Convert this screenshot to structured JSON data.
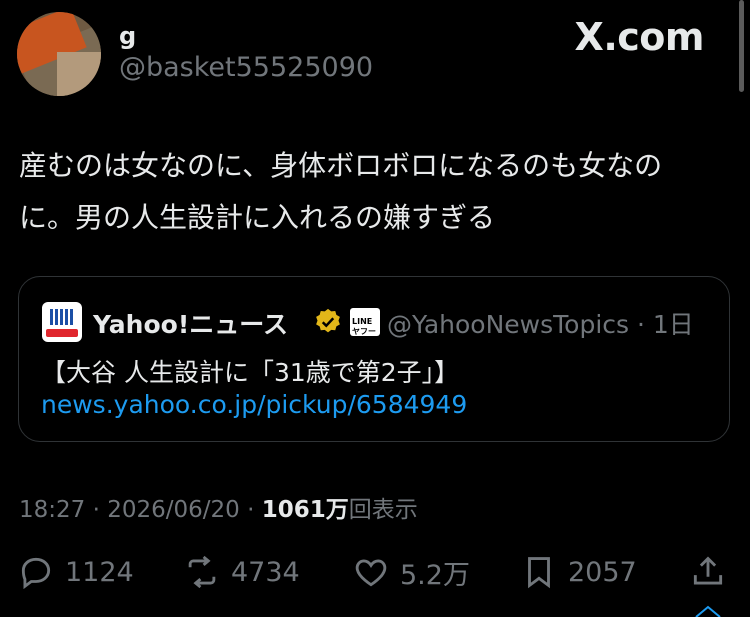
{
  "author": {
    "display_name": "g",
    "handle": "@basket55525090"
  },
  "site": "X.com",
  "tweet": {
    "line1": "産むのは女なのに、身体ボロボロになるのも女なの",
    "line2": "に。男の人生設計に入れるの嫌すぎる"
  },
  "quote": {
    "name": "Yahoo!ニュース",
    "badge_text": "LINEヤフー",
    "handle": "@YahooNewsTopics",
    "separator": "·",
    "age": "1日",
    "text": "【大谷 人生設計に「31歳で第2子」】",
    "link": "news.yahoo.co.jp/pickup/6584949"
  },
  "meta": {
    "time": "18:27",
    "sep": "·",
    "date": "2026/06/20",
    "views_count": "1061万",
    "views_label": "回表示"
  },
  "actions": {
    "replies": "1124",
    "reposts": "4734",
    "likes": "5.2万",
    "bookmarks": "2057"
  },
  "icons": [
    "reply-icon",
    "repost-icon",
    "like-icon",
    "bookmark-icon",
    "share-icon",
    "verified-badge-icon"
  ],
  "colors": {
    "background": "#000000",
    "text": "#e7e9ea",
    "muted": "#71767b",
    "link": "#1d9bf0",
    "verified": "#e2b719"
  }
}
